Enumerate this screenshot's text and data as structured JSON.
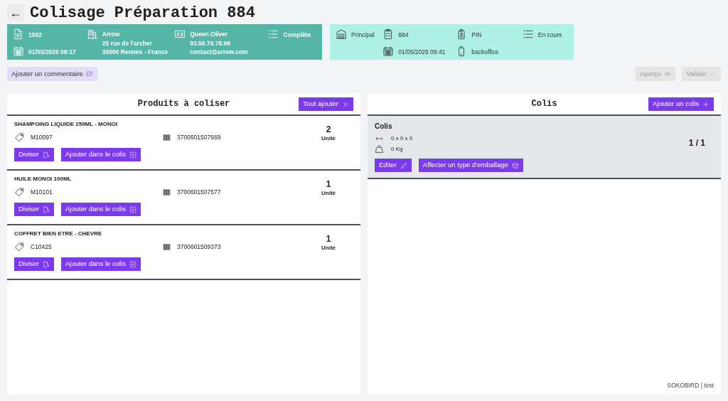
{
  "header": {
    "back_icon": "←",
    "title": "Colisage Préparation 884"
  },
  "order_card": {
    "columns": [
      [
        {
          "kind": "document",
          "lines": [
            "1002"
          ]
        },
        {
          "kind": "calendar",
          "lines": [
            "01/05/2025 09:17"
          ]
        }
      ],
      [
        {
          "kind": "building",
          "lines": [
            "Arrow",
            "25 rue de l'archer",
            "35000 Rennes - France"
          ]
        }
      ],
      [
        {
          "kind": "contact",
          "lines": [
            "Queen Oliver",
            "03.50.79.78.99",
            "contact@arrow.com"
          ]
        }
      ],
      [
        {
          "kind": "list",
          "lines": [
            "Complète"
          ]
        }
      ]
    ]
  },
  "prep_card": {
    "columns": [
      [
        {
          "kind": "warehouse",
          "lines": [
            "Principal"
          ]
        }
      ],
      [
        {
          "kind": "clipboard",
          "lines": [
            "884"
          ]
        },
        {
          "kind": "calendar",
          "lines": [
            "01/05/2025 09:41"
          ]
        }
      ],
      [
        {
          "kind": "badge",
          "lines": [
            "PIN"
          ]
        },
        {
          "kind": "phone",
          "lines": [
            "backoffice"
          ]
        }
      ],
      [
        {
          "kind": "list",
          "lines": [
            "En cours"
          ]
        }
      ]
    ]
  },
  "comment_button": "Ajouter un commentaire",
  "actions": [
    {
      "label": "Aperçu",
      "kind": "eye",
      "disabled": true
    },
    {
      "label": "Valider",
      "kind": "check",
      "disabled": true
    }
  ],
  "products_panel": {
    "title": "Produits à coliser",
    "button": "Tout ajouter",
    "items": [
      {
        "name": "SHAMPOING LIQUIDE 250ML - MONOI",
        "reference": "M10097",
        "barcode": "3700601507669",
        "quantity": "2",
        "unit": "Unité",
        "buttons": [
          "Diviser",
          "Ajouter dans le colis"
        ]
      },
      {
        "name": "HUILE MONOI 100ML",
        "reference": "M10101",
        "barcode": "3700601507577",
        "quantity": "1",
        "unit": "Unité",
        "buttons": [
          "Diviser",
          "Ajouter dans le colis"
        ]
      },
      {
        "name": "COFFRET BIEN ETRE - CHEVRE",
        "reference": "C10425",
        "barcode": "3700601509373",
        "quantity": "1",
        "unit": "Unité",
        "buttons": [
          "Diviser",
          "Ajouter dans le colis"
        ]
      }
    ]
  },
  "packages_panel": {
    "title": "Colis",
    "button": "Ajouter un colis",
    "packages": [
      {
        "name": "Colis",
        "dimensions": "0 x 0 x 0",
        "weight": "0 Kg",
        "count": "1 / 1",
        "buttons": [
          "Editer",
          "Affecter un type d'emballage"
        ]
      }
    ]
  },
  "footer": "SOKOBIRD | test"
}
